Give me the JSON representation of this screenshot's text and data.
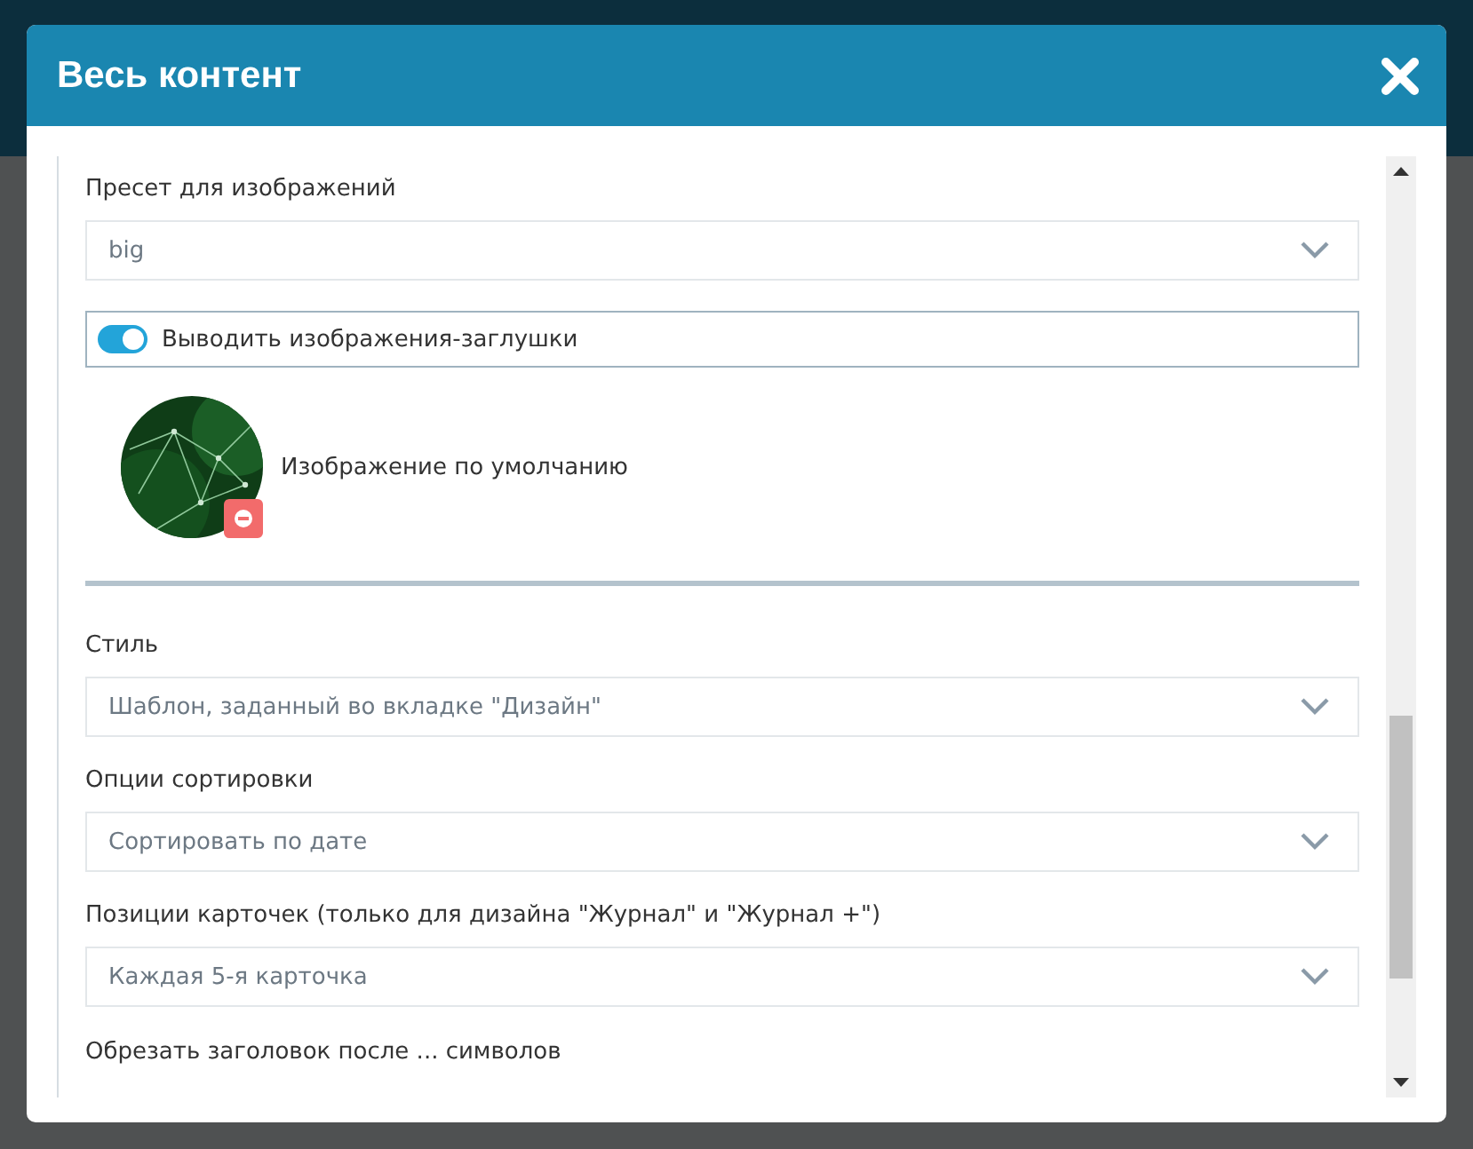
{
  "window": {
    "title": "Весь контент"
  },
  "items": [
    {
      "kind": "select",
      "label": "Пресет для изображений",
      "value": "big"
    },
    {
      "kind": "toggle",
      "label": "Выводить изображения-заглушки",
      "on": true
    },
    {
      "caption": "Изображение по умолчанию"
    },
    {
      "kind": "divider"
    },
    {
      "kind": "select",
      "label": "Стиль",
      "value": "Шаблон, заданный во вкладке \"Дизайн\""
    },
    {
      "kind": "select",
      "label": "Опции сортировки",
      "value": "Сортировать по дате"
    },
    {
      "kind": "select",
      "label": "Позиции карточек (только для дизайна \"Журнал\" и \"Журнал +\")",
      "value": "Каждая 5-я карточка"
    },
    {
      "kind": "label",
      "label": "Обрезать заголовок после ... символов"
    }
  ]
}
